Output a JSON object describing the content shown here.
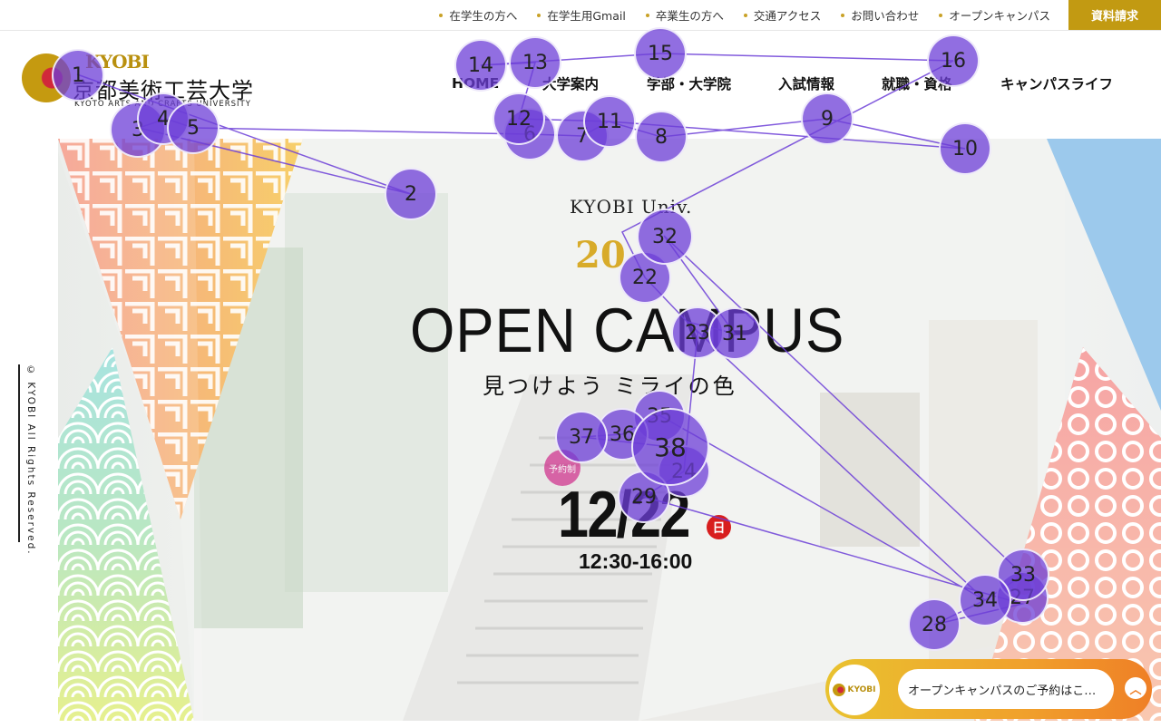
{
  "topbar": {
    "links": [
      "在学生の方へ",
      "在学生用Gmail",
      "卒業生の方へ",
      "交通アクセス",
      "お問い合わせ",
      "オープンキャンパス"
    ],
    "request_button": "資料請求"
  },
  "logo": {
    "en": "KYOBI",
    "jp": "京都美術工芸大学",
    "sub": "KYOTO ARTS AND CRAFTS UNIVERSITY"
  },
  "nav": {
    "items": [
      "HOME",
      "大学案内",
      "学部・大学院",
      "入試情報",
      "就職・資格",
      "キャンパスライフ"
    ]
  },
  "hero": {
    "univ": "KYOBI Univ.",
    "year": "20",
    "title": "OPEN CAMPUS",
    "tagline": "見つけよう ミライの色",
    "reserve_badge": "予約制",
    "date": "12/22",
    "day_of_week": "日",
    "time": "12:30-16:00"
  },
  "copyright": "© KYOBI All Rights Reserved.",
  "chat": {
    "badge": "KYOBI",
    "message": "オープンキャンパスのご予約はこ…",
    "scroll_icon": "chevron-up-icon"
  },
  "gaze": {
    "color": "#6c3ed7",
    "labels": [
      "1",
      "2",
      "3",
      "4",
      "5",
      "6",
      "7",
      "8",
      "9",
      "10",
      "11",
      "12",
      "13",
      "14",
      "15",
      "16",
      "22",
      "23",
      "24",
      "27",
      "28",
      "29",
      "31",
      "32",
      "33",
      "34",
      "35",
      "36",
      "37",
      "38"
    ]
  }
}
